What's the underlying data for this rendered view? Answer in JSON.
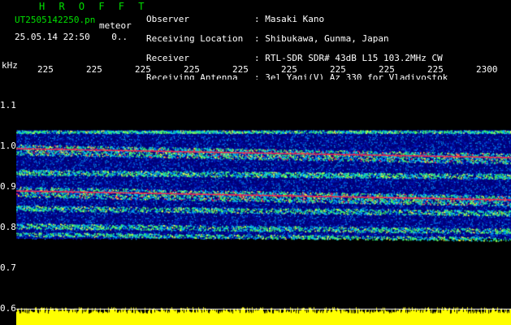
{
  "header": {
    "brand": "H R O F F T",
    "file_name": "UT2505142250.pn",
    "meteor_label": "meteor",
    "datetime": "25.05.14 22:50",
    "count": "0..",
    "observer_label": "Observer",
    "observer": "Masaki Kano",
    "location_label": "Receiving Location",
    "location": "Shibukawa, Gunma, Japan",
    "receiver_label": "Receiver",
    "receiver": "RTL-SDR SDR# 43dB L15 103.2MHz CW",
    "antenna_label": "Receiving Antenna",
    "antenna": "3el Yagi(V) Az 330 for Vladivostok"
  },
  "axes": {
    "y_unit": "kHz",
    "x_ticks": [
      "225",
      "225",
      "225",
      "225",
      "225",
      "225",
      "225",
      "225",
      "225",
      "2300"
    ],
    "y_ticks": [
      "1.1",
      "1.0",
      "0.9",
      "0.8",
      "0.7",
      "0.6"
    ]
  },
  "colors": {
    "header_green": "#00e000",
    "background": "#000000",
    "spectrum_bg": "#00008a",
    "signal": "#ff2050",
    "noise_floor": "#ffff00"
  }
}
